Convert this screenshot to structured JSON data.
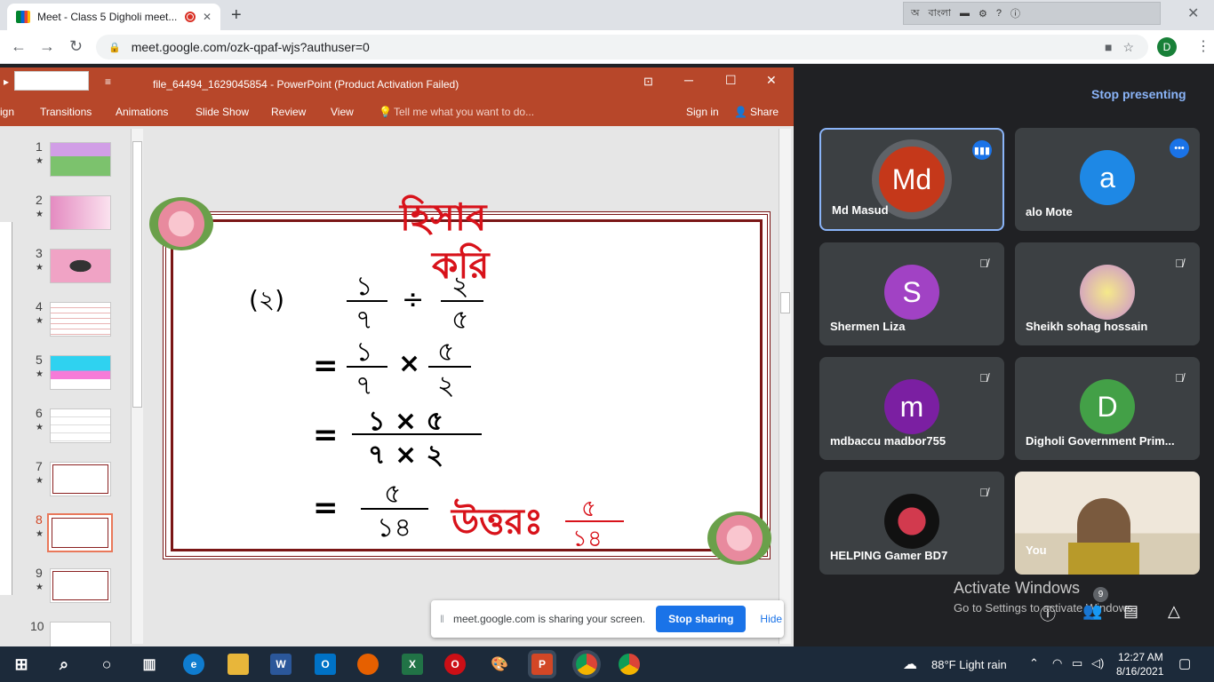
{
  "browser": {
    "tab_title": "Meet - Class 5 Digholi meet...",
    "new_tab": "+",
    "lang_label": "বাংলা",
    "url": "meet.google.com/ozk-qpaf-wjs?authuser=0",
    "profile_initial": "D"
  },
  "powerpoint": {
    "title": "file_64494_1629045854 - PowerPoint (Product Activation Failed)",
    "menu": [
      "ign",
      "Transitions",
      "Animations",
      "Slide Show",
      "Review",
      "View",
      "Tell me what you want to do..."
    ],
    "signin": "Sign in",
    "share": "Share",
    "slide_numbers": [
      "1",
      "2",
      "3",
      "4",
      "5",
      "6",
      "7",
      "8",
      "9",
      "10"
    ],
    "selected_slide": "8",
    "slide": {
      "heading1": "হিসাব",
      "heading2": "করি",
      "label": "(২)",
      "line1_num_a": "১",
      "line1_den_a": "৭",
      "line1_op": "÷",
      "line1_num_b": "২",
      "line1_den_b": "৫",
      "eq": "=",
      "line2_num_a": "১",
      "line2_den_a": "৭",
      "line2_op": "×",
      "line2_num_b": "৫",
      "line2_den_b": "২",
      "line3_num": "১ × ৫",
      "line3_den": "৭ × ২",
      "line4_num": "৫",
      "line4_den": "১৪",
      "answer_label": "উত্তরঃ",
      "answer_num": "৫",
      "answer_den": "১৪"
    }
  },
  "meet": {
    "stop_presenting": "Stop presenting",
    "participants": [
      {
        "name": "Md Masud",
        "initial": "Md",
        "color": "#c5381a",
        "state": "speaking"
      },
      {
        "name": "alo Mote",
        "initial": "a",
        "color": "#1e88e5",
        "state": "speaking"
      },
      {
        "name": "Shermen Liza",
        "initial": "S",
        "color": "#a142c4",
        "state": "muted"
      },
      {
        "name": "Sheikh sohag hossain",
        "initial": "",
        "color": "#e8d27a",
        "state": "muted"
      },
      {
        "name": "mdbaccu madbor755",
        "initial": "m",
        "color": "#7b1fa2",
        "state": "muted"
      },
      {
        "name": "Digholi Government Prim...",
        "initial": "D",
        "color": "#43a047",
        "state": "muted"
      },
      {
        "name": "HELPING Gamer BD7",
        "initial": "",
        "color": "#111111",
        "state": "muted"
      },
      {
        "name": "You",
        "initial": "",
        "color": "#d9c7a6",
        "state": "video"
      }
    ],
    "participant_count": "9",
    "activate_title": "Activate Windows",
    "activate_sub": "Go to Settings to activate Windows."
  },
  "share_banner": {
    "text": "meet.google.com is sharing your screen.",
    "stop_sharing": "Stop sharing",
    "hide": "Hide"
  },
  "taskbar": {
    "weather": "88°F  Light rain",
    "time": "12:27 AM",
    "date": "8/16/2021"
  }
}
